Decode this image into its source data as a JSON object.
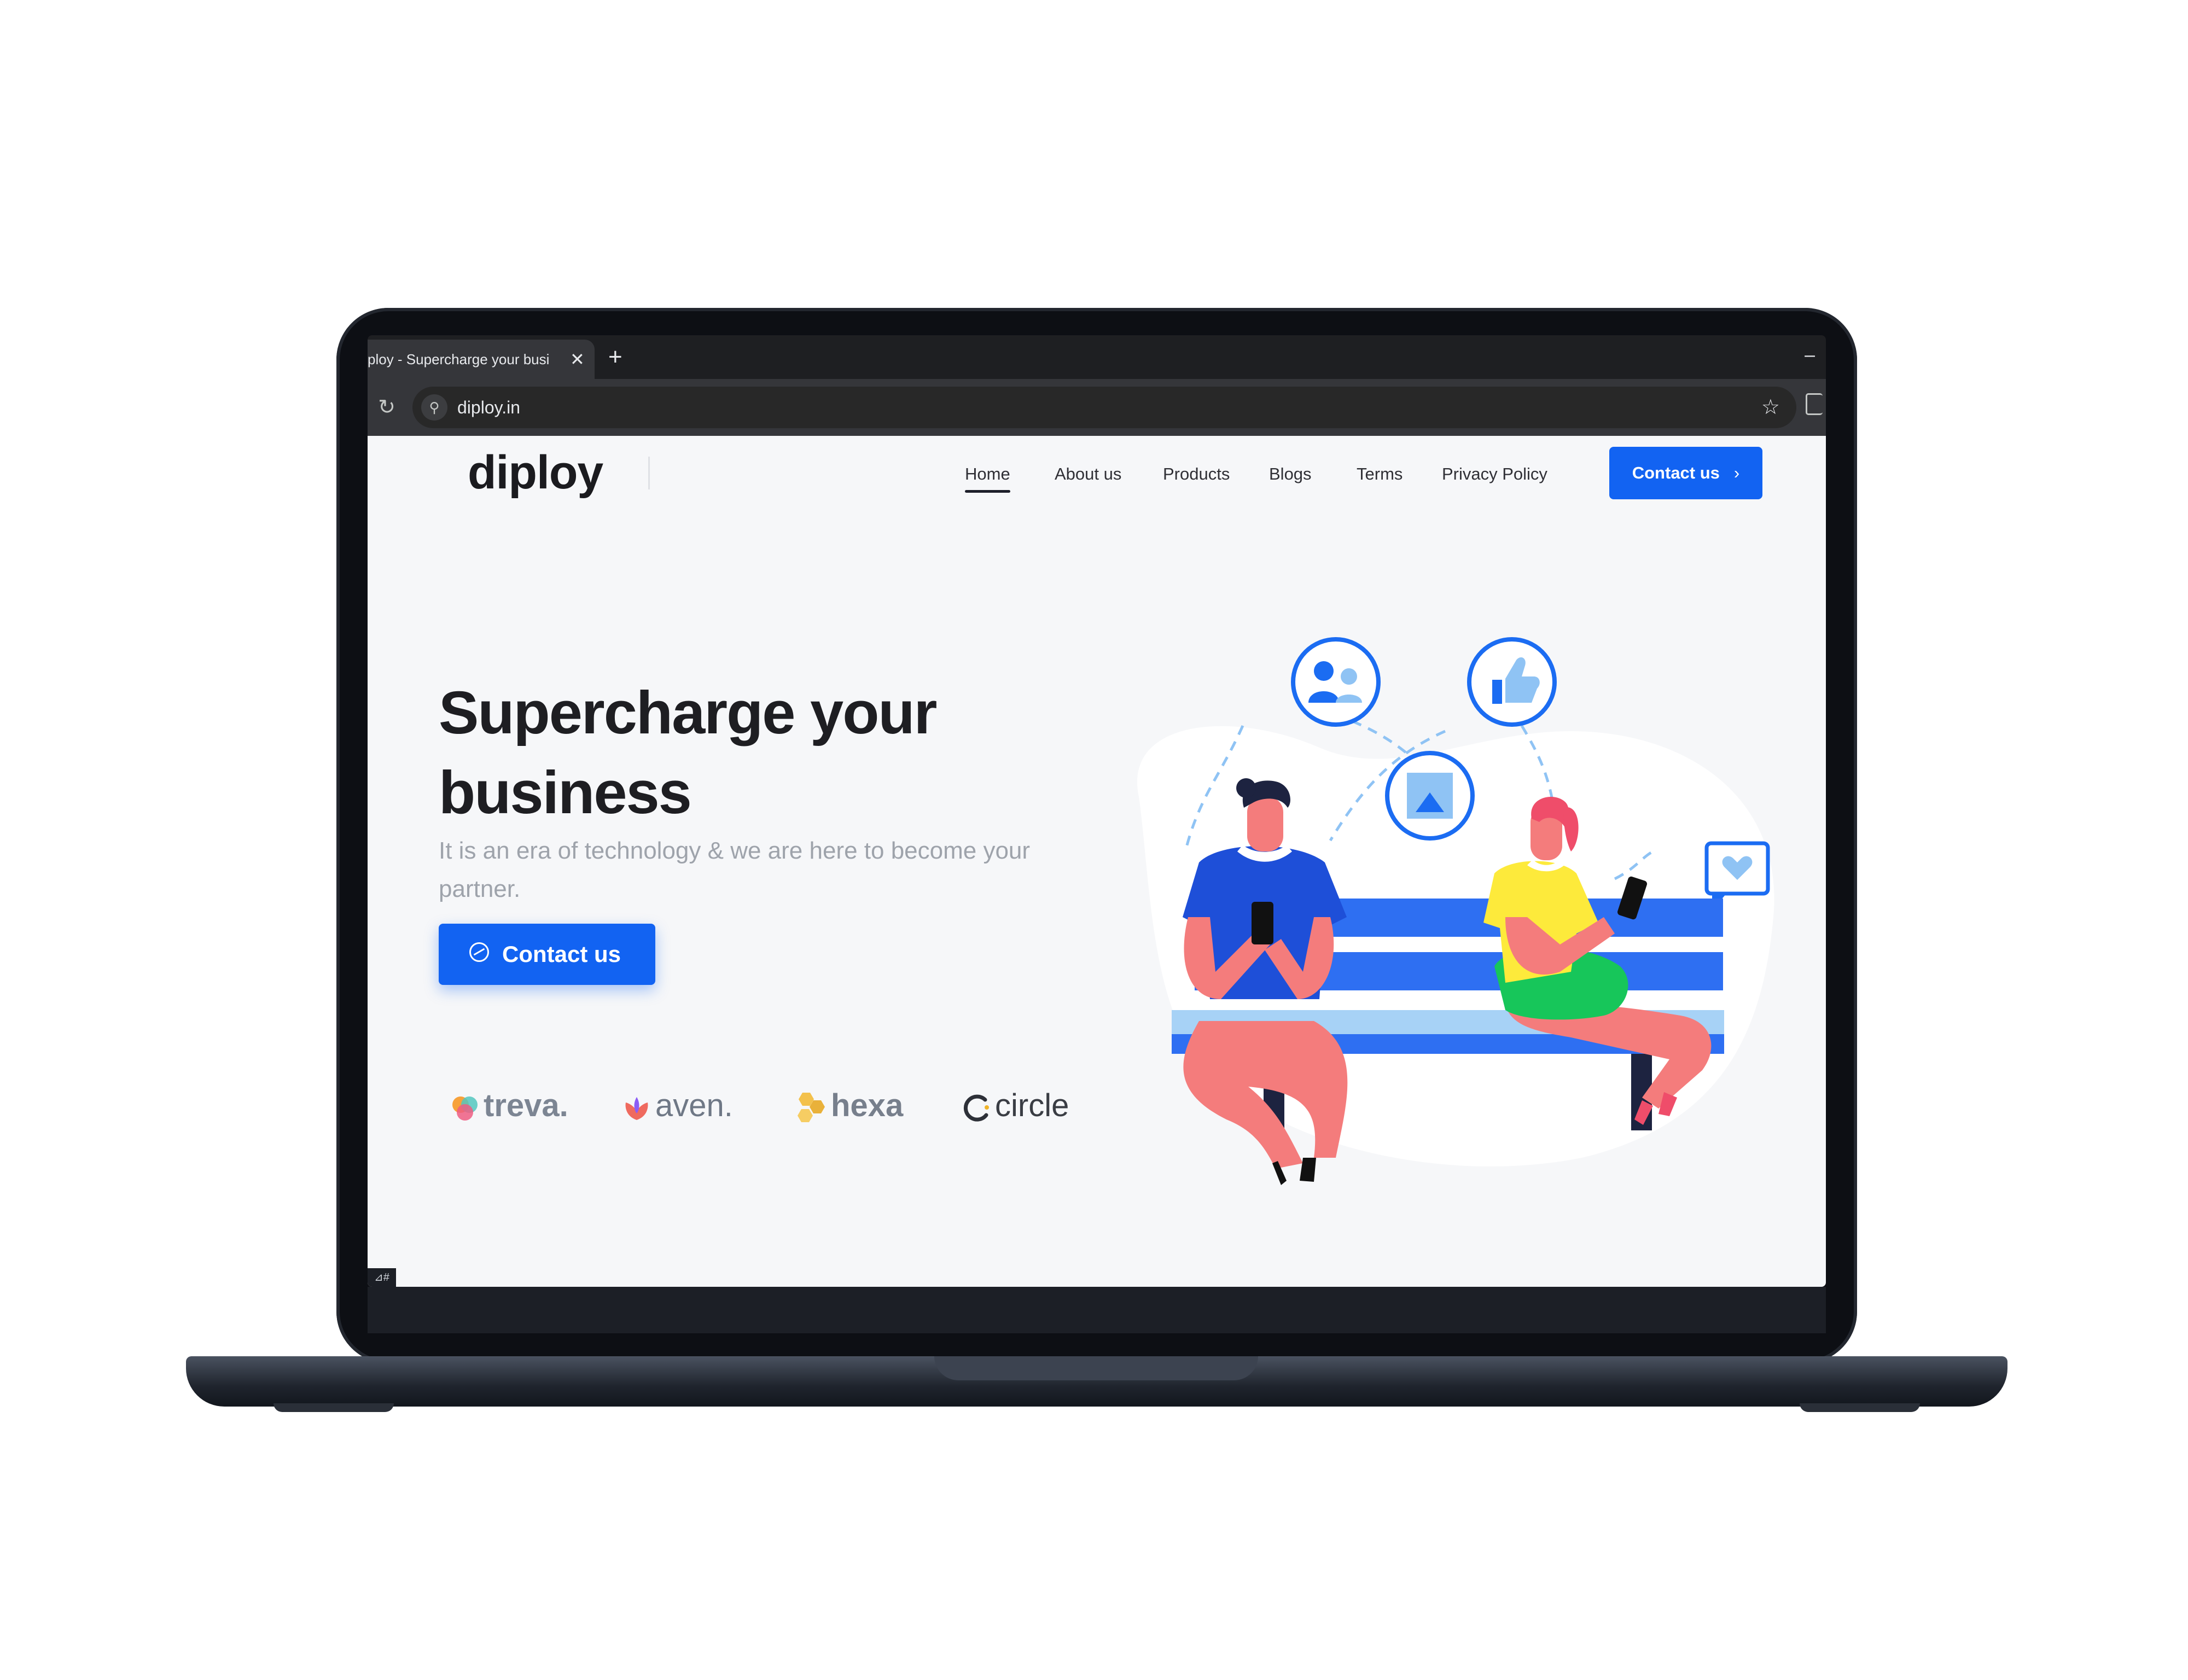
{
  "browser": {
    "tab_title": "ploy - Supercharge your busi",
    "close_glyph": "✕",
    "new_tab_glyph": "+",
    "minimize_glyph": "–",
    "reload_glyph": "↻",
    "site_info_glyph": "⚲",
    "url": "diploy.in",
    "star_glyph": "☆"
  },
  "site": {
    "logo": "diploy",
    "nav": [
      {
        "label": "Home",
        "active": true
      },
      {
        "label": "About us"
      },
      {
        "label": "Products"
      },
      {
        "label": "Blogs"
      },
      {
        "label": "Terms"
      },
      {
        "label": "Privacy Policy"
      }
    ],
    "nav_cta": {
      "label": "Contact us",
      "chevron": "›"
    },
    "hero": {
      "title_line1": "Supercharge your",
      "title_line2": "business",
      "subtitle": "It is an era of technology & we are here to become your partner.",
      "cta_label": "Contact us"
    },
    "partners": [
      {
        "name": "treva."
      },
      {
        "name": "aven."
      },
      {
        "name": "hexa"
      },
      {
        "name": "circle"
      }
    ],
    "corner_badge": "⊿#"
  },
  "colors": {
    "accent": "#1263f2",
    "page_bg": "#f6f7f9",
    "shirt_man": "#1e4fd8",
    "shirt_woman": "#fdea3b",
    "skin": "#f47c7c",
    "bench": "#2e6ff2",
    "social_icon_border": "#1b6cf2"
  },
  "icons": {
    "illustration": [
      "users-icon",
      "thumbs-up-icon",
      "image-icon",
      "heart-chat-icon"
    ]
  }
}
